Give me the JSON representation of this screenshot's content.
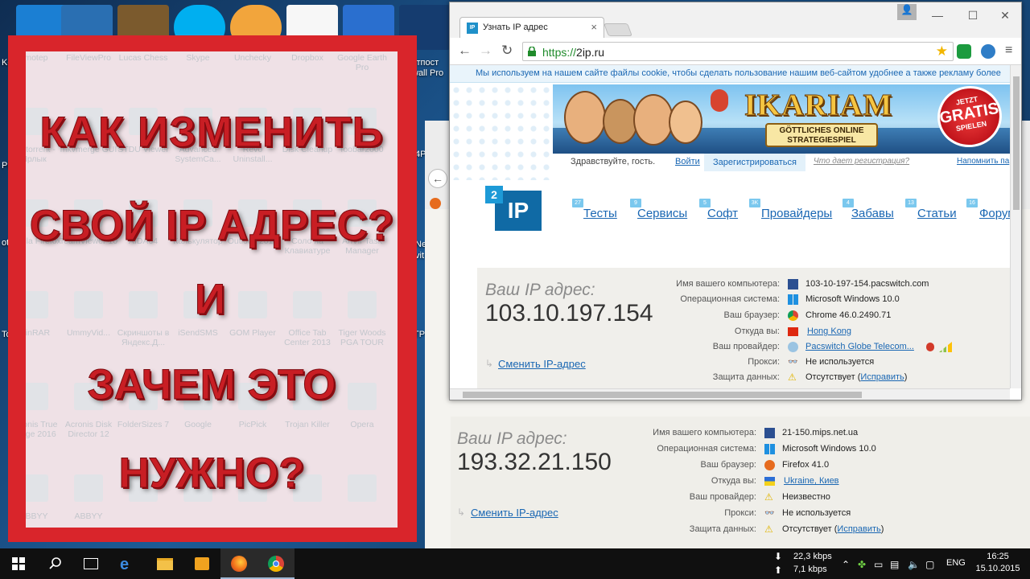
{
  "desktop": {
    "visible_labels": [
      "Ke",
      "утпост",
      "wall Pro",
      "Pr",
      "ote",
      "To",
      "4P",
      "vit",
      "Ne",
      "TP"
    ]
  },
  "thumbnail": {
    "lines": [
      "КАК  ИЗМЕНИТЬ",
      "СВОЙ IP АДРЕС?",
      "И",
      "ЗАЧЕМ ЭТО",
      "НУЖНО?"
    ],
    "ghost_icons": [
      "omotep",
      "FileViewPro",
      "Lucas Chess",
      "Skype",
      "Unchecky",
      "Dropbox",
      "Google Earth Pro",
      "qbittorrent - Ярлык",
      "mkvmerge GUI",
      "STDU Viewer",
      "Advanced SystemCa...",
      "Revo Uninstall...",
      "Disk Cleanup",
      "foobar2000",
      "Mozilla Firefox",
      "TeamViewer 10",
      "AIDA64",
      "Калькулятор",
      "Outlook 2013",
      "Соло на Клавиатуре",
      "AnVir Task Manager",
      "WinRAR",
      "UmmyVid...",
      "Скриншоты в Яндекс.Д...",
      "iSendSMS",
      "GOM Player",
      "Office Tab Center 2013",
      "Tiger Woods PGA TOUR",
      "Acronis True Image 2016",
      "Acronis Disk Director 12",
      "FolderSizes 7",
      "Google",
      "PicPick",
      "Trojan Killer",
      "Opera",
      "ABBYY",
      "ABBYY"
    ]
  },
  "browser": {
    "tab_title": "Узнать IP адрес",
    "tab_icon_text": "IP",
    "url_prefix": "https://",
    "url_host": "2ip.ru",
    "cookie_notice": "Мы используем на нашем сайте файлы cookie, чтобы сделать пользование нашим веб-сайтом удобнее а также рекламу более",
    "banner": {
      "brand": "IKARIAM",
      "subtitle": "GÖTTLICHES ONLINE STRATEGIESPIEL",
      "badge_top": "JETZT",
      "badge_main": "GRATIS",
      "badge_bottom": "SPIELEN"
    },
    "greeting": "Здравствуйте, гость.",
    "login_label": "Войти",
    "register_label": "Зарегистрироваться",
    "register_why": "Что дает регистрация?",
    "remind_label": "Напомнить па",
    "logo_small": "2",
    "logo_main": "IP",
    "nav": [
      {
        "label": "Тесты",
        "num": "27"
      },
      {
        "label": "Сервисы",
        "num": "9"
      },
      {
        "label": "Софт",
        "num": "5"
      },
      {
        "label": "Провайдеры",
        "num": "3K"
      },
      {
        "label": "Забавы",
        "num": "4"
      },
      {
        "label": "Статьи",
        "num": "13"
      },
      {
        "label": "Форум",
        "num": "16"
      }
    ],
    "ip_caption": "Ваш IP адрес:",
    "ip_value": "103.10.197.154",
    "change_link": "Сменить IP-адрес",
    "info": [
      {
        "label": "Имя вашего компьютера:",
        "value": "103-10-197-154.pacswitch.com",
        "icon": "computer-icon"
      },
      {
        "label": "Операционная система:",
        "value": "Microsoft Windows 10.0",
        "icon": "windows-icon"
      },
      {
        "label": "Ваш браузер:",
        "value": "Chrome 46.0.2490.71",
        "icon": "chrome-icon"
      },
      {
        "label": "Откуда вы:",
        "value": "Hong Kong",
        "icon": "hongkong-flag-icon",
        "link": true
      },
      {
        "label": "Ваш провайдер:",
        "value": "Pacswitch Globe Telecom...",
        "icon": "provider-icon",
        "link": true
      },
      {
        "label": "Прокси:",
        "value": "Не используется",
        "icon": "glasses-icon"
      },
      {
        "label": "Защита данных:",
        "value": "Отсутствует (",
        "link_part": "Исправить",
        "suffix": ")",
        "icon": "warning-icon"
      }
    ]
  },
  "second_window": {
    "ip_caption": "Ваш IP адрес:",
    "ip_value": "193.32.21.150",
    "change_link": "Сменить IP-адрес",
    "info": [
      {
        "label": "Имя вашего компьютера:",
        "value": "21-150.mips.net.ua",
        "icon": "computer-icon"
      },
      {
        "label": "Операционная система:",
        "value": "Microsoft Windows 10.0",
        "icon": "windows-icon"
      },
      {
        "label": "Ваш браузер:",
        "value": "Firefox 41.0",
        "icon": "firefox-icon"
      },
      {
        "label": "Откуда вы:",
        "value": "Ukraine, Киев",
        "icon": "ukraine-flag-icon",
        "link": true
      },
      {
        "label": "Ваш провайдер:",
        "value": "Неизвестно",
        "icon": "warning-icon"
      },
      {
        "label": "Прокси:",
        "value": "Не используется",
        "icon": "glasses-icon"
      },
      {
        "label": "Защита данных:",
        "value": "Отсутствует (",
        "link_part": "Исправить",
        "suffix": ")",
        "icon": "warning-icon"
      }
    ]
  },
  "taskbar": {
    "download_speed": "22,3 kbps",
    "upload_speed": "7,1 kbps",
    "language": "ENG",
    "time": "16:25",
    "date": "15.10.2015"
  },
  "colors": {
    "thumbnail_frame": "#d9252b",
    "link": "#1a67b3",
    "url_green": "#1f8b2b",
    "logo_blue": "#106aa5"
  }
}
